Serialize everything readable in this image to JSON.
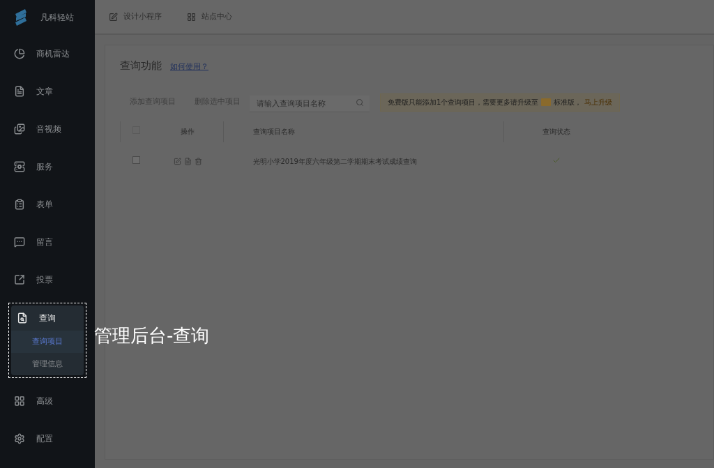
{
  "sidebar": {
    "logo_text": "凡科轻站",
    "items": [
      {
        "label": "商机雷达",
        "selected": false
      },
      {
        "label": "文章",
        "selected": false
      },
      {
        "label": "音视频",
        "selected": false
      },
      {
        "label": "服务",
        "selected": false
      },
      {
        "label": "表单",
        "selected": false
      },
      {
        "label": "留言",
        "selected": false
      },
      {
        "label": "投票",
        "selected": false
      },
      {
        "label": "查询",
        "selected": true,
        "expanded": true,
        "children": [
          {
            "label": "查询项目",
            "selected": true
          },
          {
            "label": "管理信息",
            "selected": false
          }
        ]
      },
      {
        "label": "高级",
        "selected": false
      },
      {
        "label": "配置",
        "selected": false
      }
    ]
  },
  "header": {
    "links": [
      "设计小程序",
      "站点中心"
    ]
  },
  "page": {
    "title": "查询功能",
    "help_link": "如何使用？",
    "toolbar": {
      "buttons": [
        {
          "label": "添加查询项目",
          "disabled": true
        },
        {
          "label": "删除选中项目",
          "disabled": true
        }
      ],
      "search": {
        "placeholder": "请输入查询项目名称"
      },
      "notice": {
        "text": "免费版只能添加1个查询项目，需要更多请升级至",
        "edition": "标准版，",
        "link": "马上升级"
      }
    },
    "table": {
      "header_checked": false,
      "columns": [
        "操作",
        "查询项目名称",
        "查询状态"
      ],
      "rows": [
        {
          "checked": false,
          "name": "光明小学2019年度六年级第二学期期末考试成绩查询",
          "active": true
        }
      ]
    }
  },
  "annotation": {
    "text": "管理后台-查询"
  }
}
